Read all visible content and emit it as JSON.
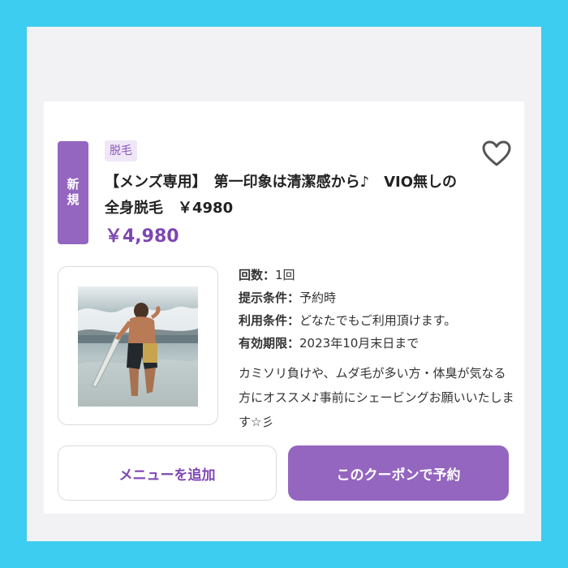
{
  "coupon": {
    "new_badge": "新規",
    "category": "脱毛",
    "title": "【メンズ専用】　第一印象は清潔感から♪　VIO無しの全身脱毛　￥4980",
    "price": "￥4,980",
    "image_icon": "surfer-photo",
    "favorite_icon": "heart-outline-icon",
    "details": [
      {
        "label": "回数：",
        "value": "1回"
      },
      {
        "label": "提示条件：",
        "value": "予約時"
      },
      {
        "label": "利用条件：",
        "value": "どなたでもご利用頂けます。"
      },
      {
        "label": "有効期限：",
        "value": "2023年10月末日まで"
      }
    ],
    "description": "カミソリ負けや、ムダ毛が多い方・体臭が気なる方にオススメ♪事前にシェービングお願いいたします☆彡"
  },
  "actions": {
    "add_menu_label": "メニューを追加",
    "reserve_label": "このクーポンで予約"
  },
  "colors": {
    "frame": "#3dcdf1",
    "accent": "#9466bf",
    "price": "#7e46b2"
  }
}
